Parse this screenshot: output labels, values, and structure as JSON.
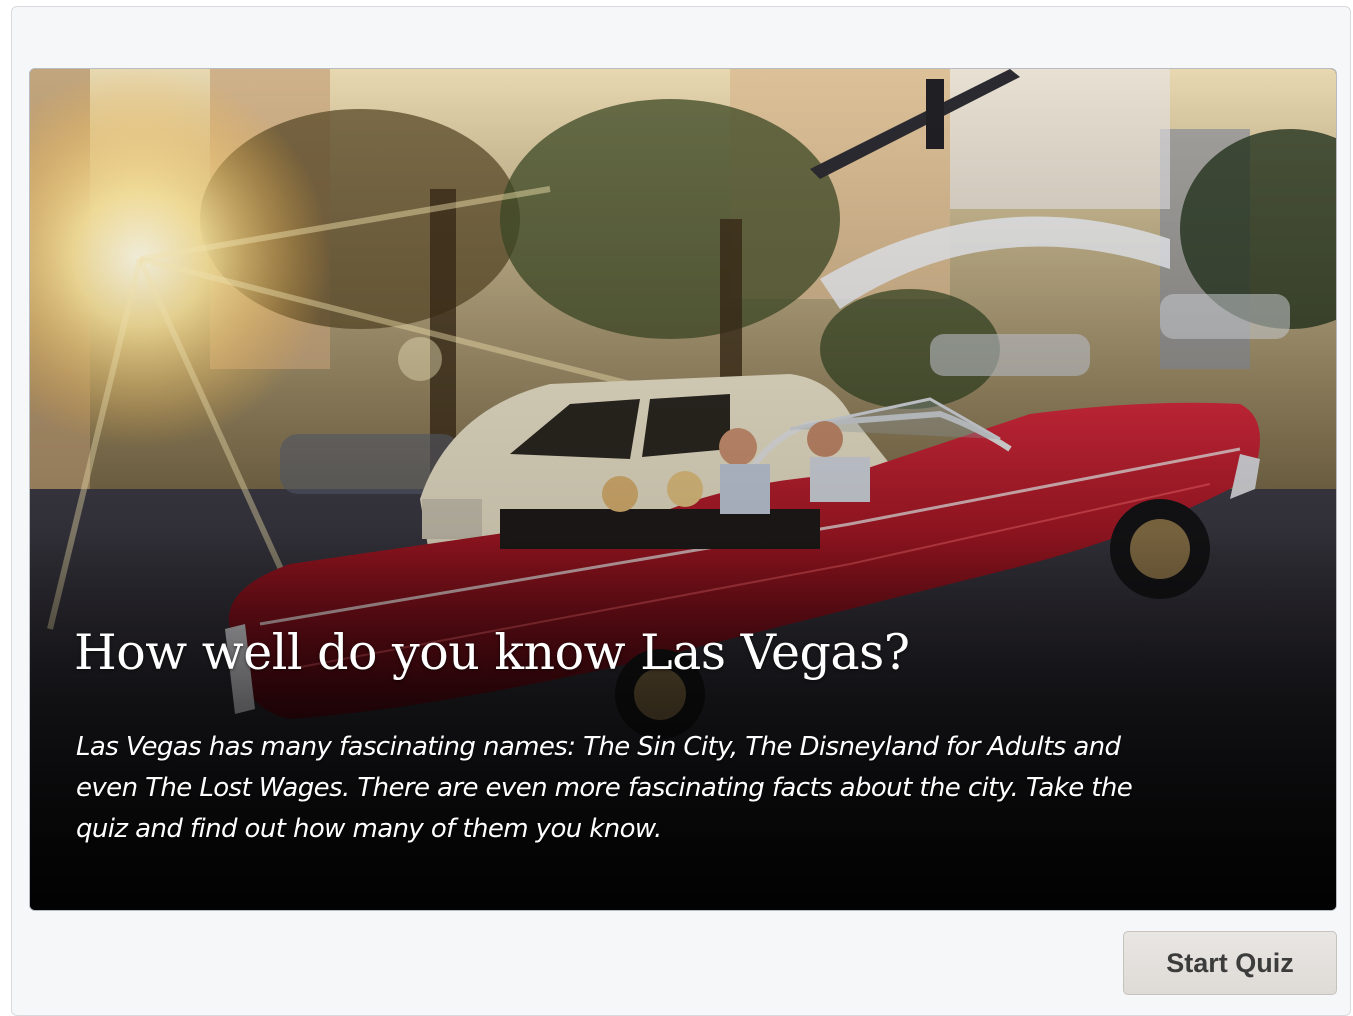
{
  "quiz": {
    "title": "How well do you know Las Vegas?",
    "description": "Las Vegas has many fascinating names: The Sin City, The Disneyland for Adults and even The Lost Wages. There are even more fascinating facts about the city. Take the quiz and find out how many of them you know.",
    "start_button_label": "Start Quiz"
  },
  "hero_image": {
    "subject": "red vintage convertible on a Las Vegas street with sun flare",
    "accent_color": "#a01818"
  }
}
